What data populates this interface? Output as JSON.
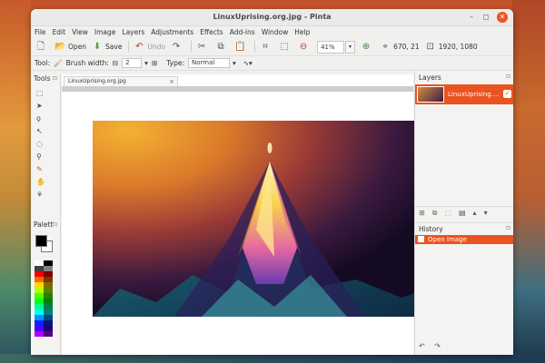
{
  "window": {
    "title": "LinuxUprising.org.jpg - Pinta",
    "controls": {
      "minimize": "–",
      "maximize": "◻",
      "close": "✕"
    }
  },
  "menu": [
    "File",
    "Edit",
    "View",
    "Image",
    "Layers",
    "Adjustments",
    "Effects",
    "Add-ins",
    "Window",
    "Help"
  ],
  "toolbar": {
    "open_label": "Open",
    "save_label": "Save",
    "undo_label": "Undo",
    "zoom_value": "41%",
    "cursor_position": "670, 21",
    "image_size": "1920, 1080"
  },
  "tool_options": {
    "tool_label": "Tool:",
    "brush_width_label": "Brush width:",
    "brush_width_value": "2",
    "type_label": "Type:",
    "type_value": "Normal"
  },
  "panels": {
    "tools_title": "Tools",
    "palette_title": "Palett",
    "layers_title": "Layers",
    "history_title": "History"
  },
  "document": {
    "tab_title": "LinuxUprising.org.jpg"
  },
  "layers": [
    {
      "name": "LinuxUprising....",
      "visible": true
    }
  ],
  "history": [
    {
      "label": "Open Image"
    }
  ],
  "colors": {
    "accent": "#e95420",
    "primary": "#000000",
    "secondary": "#ffffff"
  },
  "palette_colors": [
    "#ffffff",
    "#000000",
    "#404040",
    "#808080",
    "#ff0000",
    "#800000",
    "#ff6a00",
    "#7f3300",
    "#ffd800",
    "#7f6a00",
    "#b6ff00",
    "#5b7f00",
    "#4cff00",
    "#267f00",
    "#00ff21",
    "#007f0e",
    "#00ff90",
    "#007f46",
    "#00ffff",
    "#007f7f",
    "#0094ff",
    "#004a7f",
    "#0026ff",
    "#00137f",
    "#4800ff",
    "#21007f",
    "#b200ff",
    "#57007f"
  ]
}
